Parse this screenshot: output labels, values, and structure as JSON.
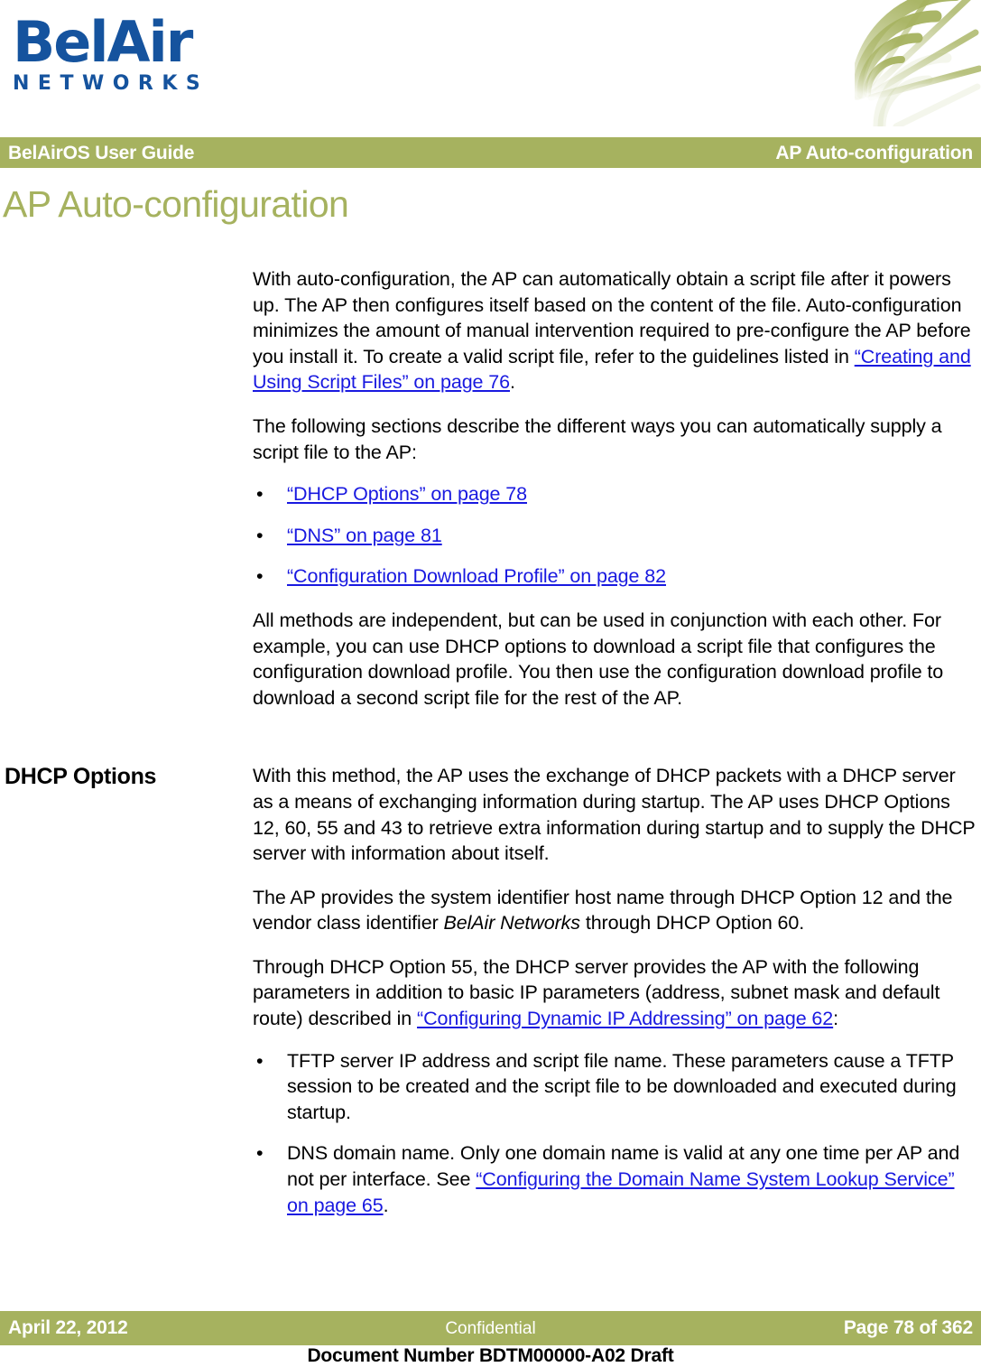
{
  "brand": {
    "logo_wordmark": "BelAir",
    "logo_subtext": "NETWORKS",
    "logo_color": "#15539E",
    "accent_color": "#A6B25F",
    "link_color": "#1919E0"
  },
  "header": {
    "left": "BelAirOS User Guide",
    "right": "AP Auto-configuration"
  },
  "chapter_title": "AP Auto-configuration",
  "sections": [
    {
      "heading": "",
      "paragraphs": [
        {
          "id": "p1",
          "parts": [
            {
              "type": "text",
              "value": "With auto-configuration, the AP can automatically obtain a script file after it powers up. The AP then configures itself based on the content of the file. Auto-configuration minimizes the amount of manual intervention required to pre-configure the AP before you install it. To create a valid script file, refer to the guidelines listed in "
            },
            {
              "type": "link",
              "value": "“Creating and Using Script Files” on page 76"
            },
            {
              "type": "text",
              "value": "."
            }
          ]
        },
        {
          "id": "p2",
          "parts": [
            {
              "type": "text",
              "value": "The following sections describe the different ways you can automatically supply a script file to the AP:"
            }
          ]
        }
      ],
      "bullets": [
        {
          "marker": "•",
          "link": "“DHCP Options” on page 78",
          "after": ""
        },
        {
          "marker": "•",
          "link": "“DNS” on page 81",
          "after": ""
        },
        {
          "marker": "•",
          "link": "“Configuration Download Profile” on page 82",
          "after": ""
        }
      ],
      "closing_paragraph": "All methods are independent, but can be used in conjunction with each other. For example, you can use DHCP options to download a script file that configures the configuration download profile. You then use the configuration download profile to download a second script file for the rest of the AP."
    }
  ],
  "dhcp_section": {
    "heading": "DHCP Options",
    "p1": "With this method, the AP uses the exchange of DHCP packets with a DHCP server as a means of exchanging information during startup. The AP uses DHCP Options 12, 60, 55 and 43 to retrieve extra information during startup and to supply the DHCP server with information about itself.",
    "p2_before": "The AP provides the system identifier host name through DHCP Option 12 and the vendor class identifier ",
    "p2_italic": "BelAir Networks",
    "p2_after": " through DHCP Option 60.",
    "p3_before": "Through DHCP Option 55, the DHCP server provides the AP with the following parameters in addition to basic IP parameters (address, subnet mask and default route) described in ",
    "p3_link": "“Configuring Dynamic IP Addressing” on page 62",
    "p3_after": ":",
    "bullets": [
      {
        "marker": "•",
        "text": "TFTP server IP address and script file name. These parameters cause a TFTP session to be created and the script file to be downloaded and executed during startup.",
        "link": "",
        "after": ""
      },
      {
        "marker": "•",
        "text": "DNS domain name. Only one domain name is valid at any one time per AP and not per interface. See ",
        "link": "“Configuring the Domain Name System Lookup Service” on page 65",
        "after": "."
      }
    ]
  },
  "footer": {
    "date": "April 22, 2012",
    "classification": "Confidential",
    "page": "Page 78 of 362",
    "document_number": "Document Number BDTM00000-A02 Draft"
  }
}
